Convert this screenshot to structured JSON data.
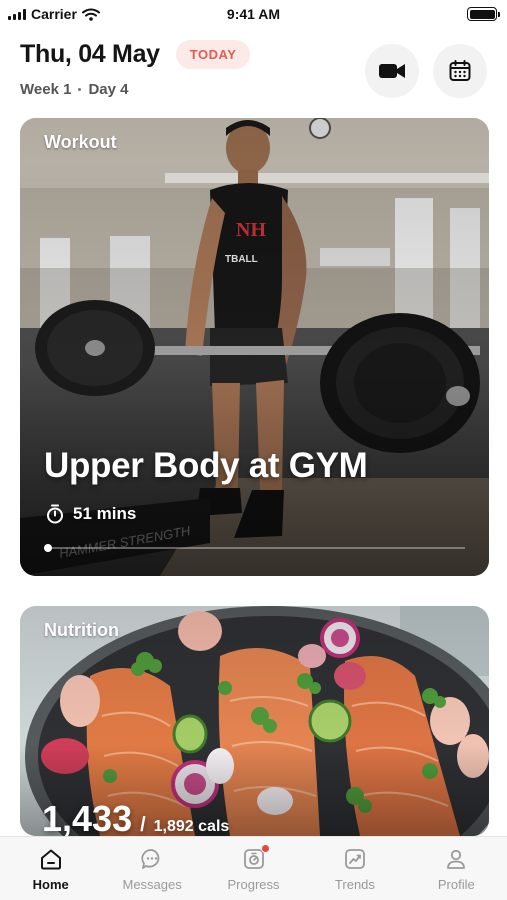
{
  "status_bar": {
    "carrier": "Carrier",
    "time": "9:41 AM"
  },
  "header": {
    "date": "Thu, 04 May",
    "today_badge": "TODAY",
    "week": "Week 1",
    "day": "Day 4",
    "actions": [
      {
        "icon": "video-camera-icon"
      },
      {
        "icon": "calendar-icon"
      }
    ]
  },
  "workout_card": {
    "label": "Workout",
    "title": "Upper Body at GYM",
    "duration": "51 mins",
    "image": "man-lifting-barbell-in-gym-photo"
  },
  "nutrition_card": {
    "label": "Nutrition",
    "calories_current": "1,433",
    "separator": "/",
    "calories_goal": "1,892 cals",
    "image": "salmon-fillets-with-radishes-photo"
  },
  "tab_bar": {
    "tabs": [
      {
        "label": "Home",
        "icon": "home-icon",
        "active": true
      },
      {
        "label": "Messages",
        "icon": "chat-bubble-icon",
        "active": false
      },
      {
        "label": "Progress",
        "icon": "progress-icon",
        "active": false,
        "badge": true
      },
      {
        "label": "Trends",
        "icon": "trend-chart-icon",
        "active": false
      },
      {
        "label": "Profile",
        "icon": "person-icon",
        "active": false
      }
    ]
  },
  "colors": {
    "accent": "#e85a4f",
    "badge_bg": "#fbeae7",
    "active_tab": "#151515",
    "inactive_tab": "#9a9a9a"
  }
}
